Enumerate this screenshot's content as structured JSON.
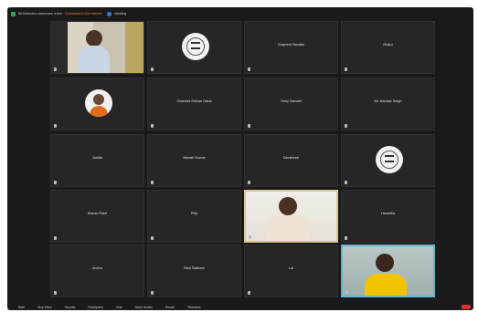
{
  "topbar": {
    "title": "Mr.Solenda's classroom is live",
    "warning": "Connected to the internet",
    "meeting": "Meeting"
  },
  "tiles": [
    {
      "name": "",
      "sub": "",
      "kind": "video"
    },
    {
      "name": "",
      "sub": "",
      "kind": "logo"
    },
    {
      "name": "Gurpreet Sandhu",
      "sub": "",
      "kind": "text"
    },
    {
      "name": "Mukul",
      "sub": "",
      "kind": "text"
    },
    {
      "name": "",
      "sub": "",
      "kind": "person"
    },
    {
      "name": "Chandra Sekhar Garai",
      "sub": "",
      "kind": "text"
    },
    {
      "name": "Sony Samuel",
      "sub": "",
      "kind": "text"
    },
    {
      "name": "Mr. Kanwar Singh",
      "sub": "",
      "kind": "text"
    },
    {
      "name": "Ankita",
      "sub": "",
      "kind": "text"
    },
    {
      "name": "Manish Kumar",
      "sub": "",
      "kind": "text"
    },
    {
      "name": "Devishree",
      "sub": "",
      "kind": "text"
    },
    {
      "name": "",
      "sub": "",
      "kind": "logo"
    },
    {
      "name": "Kishan Patel",
      "sub": "",
      "kind": "text"
    },
    {
      "name": "Prity",
      "sub": "",
      "kind": "text"
    },
    {
      "name": "",
      "sub": "",
      "kind": "video"
    },
    {
      "name": "Harshika",
      "sub": "",
      "kind": "text"
    },
    {
      "name": "Anshu",
      "sub": "",
      "kind": "text"
    },
    {
      "name": "Ravi Rathore",
      "sub": "",
      "kind": "text"
    },
    {
      "name": "Lal",
      "sub": "",
      "kind": "text"
    },
    {
      "name": "",
      "sub": "",
      "kind": "video"
    }
  ],
  "bottombar": {
    "items": [
      "Mute",
      "Stop Video",
      "Security",
      "Participants",
      "Chat",
      "Share Screen",
      "Record",
      "Reactions"
    ],
    "end_label": ""
  },
  "colors": {
    "bg": "#1a1a1a",
    "tile": "#262626",
    "accent_orange": "#d39a2a",
    "end_red": "#e02d2d"
  }
}
